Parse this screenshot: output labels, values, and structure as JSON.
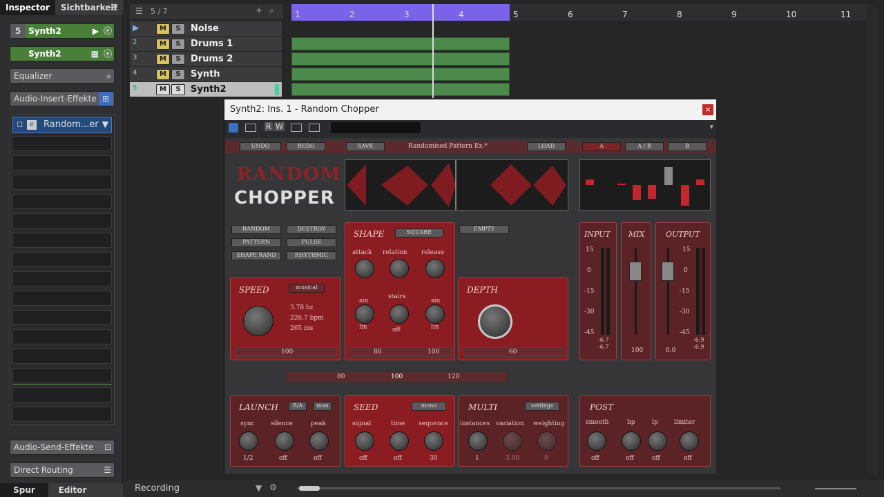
{
  "inspector": {
    "tabs": [
      "Inspector",
      "Sichtbarkeit"
    ],
    "track1": {
      "number": "5",
      "label": "Synth2"
    },
    "track2": {
      "label": "Synth2"
    },
    "equalizer": "Equalizer",
    "insert_effects": "Audio-Insert-Effekte",
    "insert_slot": "Random...er",
    "send_effects": "Audio-Send-Effekte",
    "direct_routing": "Direct Routing",
    "bottom_tabs": [
      "Spur",
      "Editor"
    ]
  },
  "arrange": {
    "track_count": "5 / 7",
    "tracks": [
      {
        "num": "",
        "name": "Noise"
      },
      {
        "num": "2",
        "name": "Drums 1"
      },
      {
        "num": "3",
        "name": "Drums 2"
      },
      {
        "num": "4",
        "name": "Synth"
      },
      {
        "num": "5",
        "name": "Synth2"
      }
    ],
    "mute_label": "M",
    "solo_label": "S",
    "ruler_numbers": [
      "1",
      "2",
      "3",
      "4",
      "5",
      "6",
      "7",
      "8",
      "9",
      "10",
      "11"
    ],
    "status_label": "Recording"
  },
  "plugin": {
    "title": "Synth2: Ins. 1 - Random Chopper",
    "toolbar": {
      "rw_r": "R",
      "rw_w": "W"
    },
    "top_buttons": {
      "undo": "UNDO",
      "redo": "REDO",
      "save": "SAVE",
      "preset": "Randomised Pattern Ex.*",
      "load": "LOAD",
      "a": "A",
      "ab": "A / B",
      "b": "B"
    },
    "logo": {
      "line1": "RANDOM",
      "line2": "CHOPPER"
    },
    "mode_buttons": [
      "RANDOM",
      "DESTROY",
      "PATTERN",
      "PULSE",
      "SHAPE RAND",
      "RHYTHMIC"
    ],
    "empty_button": "EMPTY",
    "shape": {
      "title": "SHAPE",
      "mode": "SQUARE",
      "labels": [
        "attack",
        "relation",
        "release"
      ],
      "stairs": "stairs",
      "sin_left": "sin",
      "sin_right": "sin",
      "lin_left": "lin",
      "lin_right": "lin",
      "off": "off",
      "slider_values": [
        "80",
        "100"
      ]
    },
    "speed": {
      "title": "SPEED",
      "mode": "musical",
      "hz": "3.78 hz",
      "bpm": "226.7 bpm",
      "ms": "265 ms",
      "slider_value": "100"
    },
    "depth": {
      "title": "DEPTH",
      "slider_value": "60"
    },
    "center_slider": {
      "values": [
        "80",
        "100",
        "120"
      ]
    },
    "input": {
      "title": "INPUT",
      "ticks": [
        "15",
        "0",
        "-15",
        "-30",
        "-45"
      ],
      "readout": "-6.7",
      "readout2": "-6.7"
    },
    "mix": {
      "title": "MIX",
      "value": "100"
    },
    "output": {
      "title": "OUTPUT",
      "ticks": [
        "15",
        "0",
        "-15",
        "-30",
        "-45"
      ],
      "value": "0.0",
      "readout": "-6.9",
      "readout2": "-6.9"
    },
    "launch": {
      "title": "LAUNCH",
      "ba": "B/A",
      "man": "man",
      "labels": [
        "sync",
        "silence",
        "peak"
      ],
      "values": [
        "1/2",
        "off",
        "off"
      ]
    },
    "seed": {
      "title": "SEED",
      "mode": "mono",
      "labels": [
        "signal",
        "time",
        "sequence"
      ],
      "values": [
        "off",
        "off",
        "30"
      ]
    },
    "multi": {
      "title": "MULTI",
      "settings": "settings",
      "labels": [
        "instances",
        "variation",
        "weighting"
      ],
      "values": [
        "1",
        "3.00",
        "0"
      ]
    },
    "post": {
      "title": "POST",
      "labels": [
        "smooth",
        "hp",
        "lp",
        "limiter"
      ],
      "values": [
        "off",
        "off",
        "off",
        "off"
      ]
    }
  },
  "colors": {
    "accent": "#8b1d22",
    "timeline": "#7a63e8",
    "track_green": "#4a7f3a"
  }
}
